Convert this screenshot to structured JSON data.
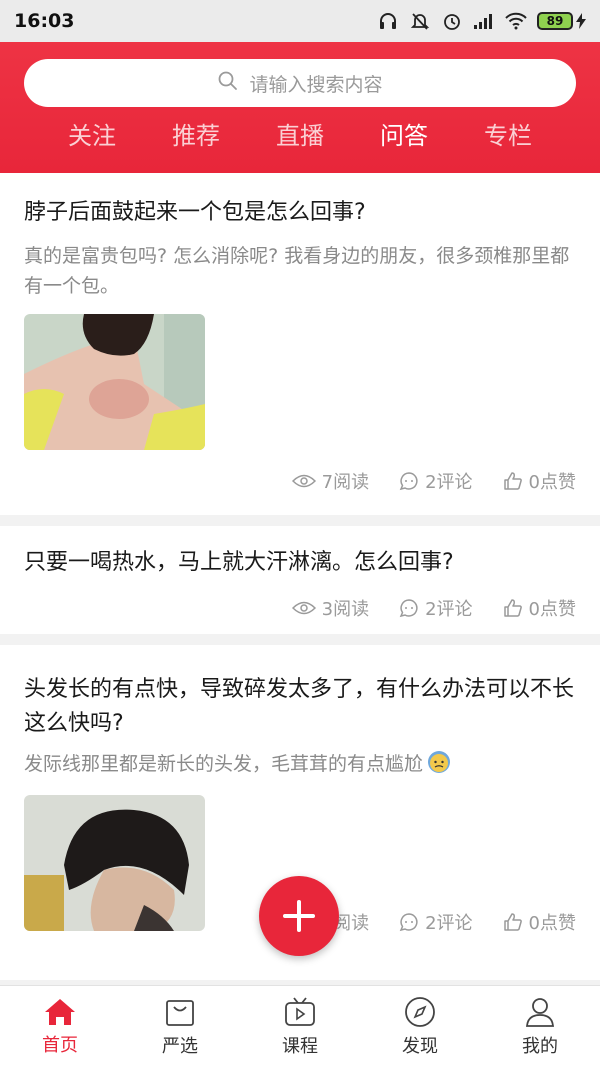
{
  "status_bar": {
    "time": "16:03",
    "battery": "89"
  },
  "search": {
    "placeholder": "请输入搜索内容"
  },
  "tabs": [
    {
      "label": "关注"
    },
    {
      "label": "推荐"
    },
    {
      "label": "直播"
    },
    {
      "label": "问答"
    },
    {
      "label": "专栏"
    }
  ],
  "posts": [
    {
      "title": "脖子后面鼓起来一个包是怎么回事?",
      "desc": "真的是富贵包吗? 怎么消除呢? 我看身边的朋友，很多颈椎那里都有一个包。",
      "reads": "7阅读",
      "comments": "2评论",
      "likes": "0点赞"
    },
    {
      "title": "只要一喝热水，马上就大汗淋漓。怎么回事?",
      "reads": "3阅读",
      "comments": "2评论",
      "likes": "0点赞"
    },
    {
      "title": "头发长的有点快，导致碎发太多了，有什么办法可以不长这么快吗?",
      "desc": "发际线那里都是新长的头发，毛茸茸的有点尴尬",
      "reads": "26阅读",
      "comments": "2评论",
      "likes": "0点赞"
    }
  ],
  "bottom_nav": [
    {
      "label": "首页",
      "icon": "home-icon"
    },
    {
      "label": "严选",
      "icon": "shopping-bag-icon"
    },
    {
      "label": "课程",
      "icon": "tv-play-icon"
    },
    {
      "label": "发现",
      "icon": "compass-icon"
    },
    {
      "label": "我的",
      "icon": "user-icon"
    }
  ],
  "colors": {
    "accent": "#e8263a",
    "muted": "#9a9a9a"
  }
}
